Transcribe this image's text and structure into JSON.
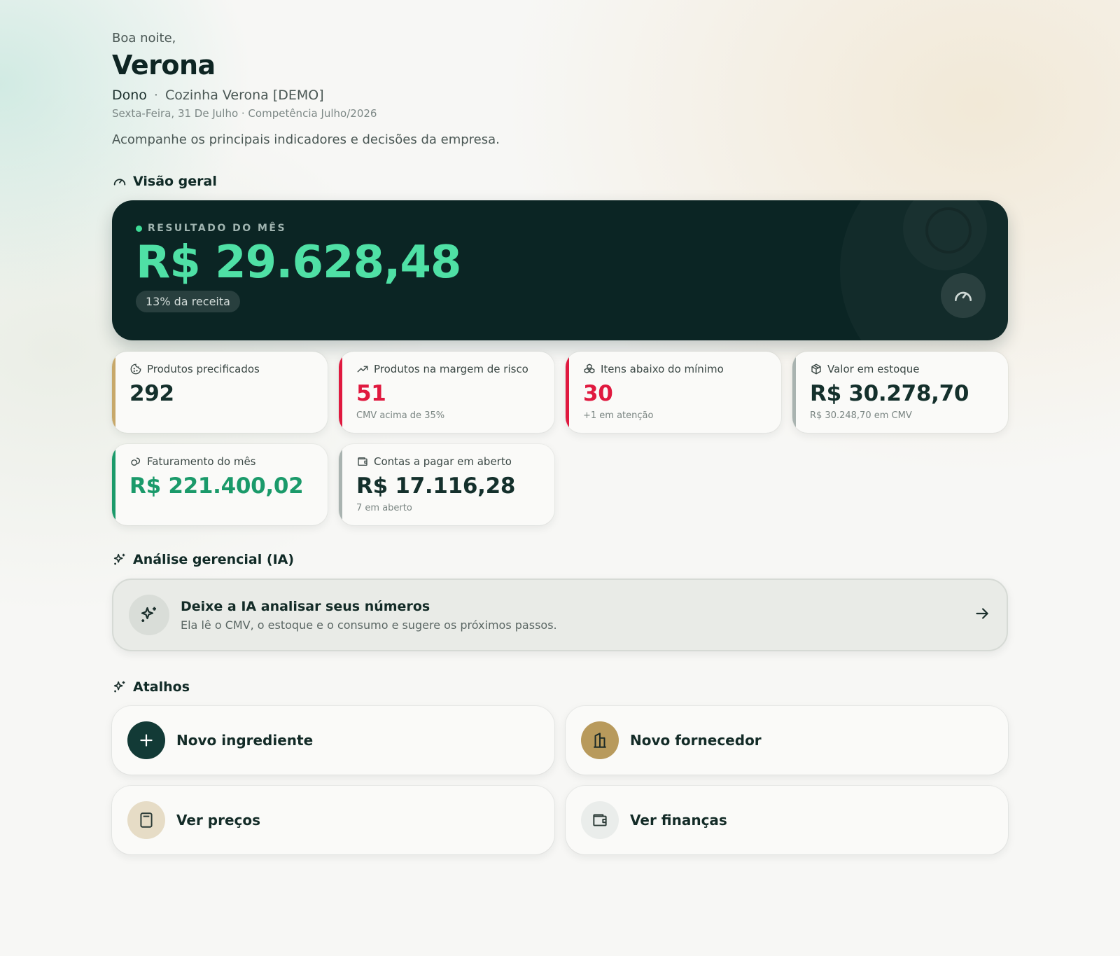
{
  "header": {
    "greeting": "Boa noite,",
    "name": "Verona",
    "role": "Dono",
    "separator": "·",
    "company": "Cozinha Verona [DEMO]",
    "date": "Sexta-Feira, 31 De Julho · Competência Julho/2026",
    "intro": "Acompanhe os principais indicadores e decisões da empresa."
  },
  "overview": {
    "title": "Visão geral",
    "icon": "gauge-icon",
    "hero": {
      "label": "RESULTADO DO MÊS",
      "value": "R$ 29.628,48",
      "pill": "13% da receita",
      "value_color": "#4fe0a5",
      "background": "#0b2524"
    },
    "kpis": [
      {
        "label": "Produtos precificados",
        "icon": "cookie-icon",
        "value": "292",
        "sub": "",
        "accent": "#c7a86a",
        "tone": "default"
      },
      {
        "label": "Produtos na margem de risco",
        "icon": "trending-up-icon",
        "value": "51",
        "sub": "CMV acima de 35%",
        "accent": "#e0193f",
        "tone": "red"
      },
      {
        "label": "Itens abaixo do mínimo",
        "icon": "boxes-icon",
        "value": "30",
        "sub": "+1 em atenção",
        "accent": "#e0193f",
        "tone": "red"
      },
      {
        "label": "Valor em estoque",
        "icon": "package-icon",
        "value": "R$ 30.278,70",
        "sub": "R$ 30.248,70 em CMV",
        "accent": "#a9b3b0",
        "tone": "default"
      },
      {
        "label": "Faturamento do mês",
        "icon": "coins-icon",
        "value": "R$ 221.400,02",
        "sub": "",
        "accent": "#1a9a6a",
        "tone": "green"
      },
      {
        "label": "Contas a pagar em aberto",
        "icon": "wallet-icon",
        "value": "R$ 17.116,28",
        "sub": "7 em aberto",
        "accent": "#a9b3b0",
        "tone": "default"
      }
    ]
  },
  "ia": {
    "title": "Análise gerencial (IA)",
    "icon": "sparkles-icon",
    "card_title": "Deixe a IA analisar seus números",
    "card_sub": "Ela lê o CMV, o estoque e o consumo e sugere os próximos passos."
  },
  "shortcuts": {
    "title": "Atalhos",
    "icon": "sparkles-icon",
    "items": [
      {
        "label": "Novo ingrediente",
        "icon": "plus-icon",
        "bg": "#123a36",
        "fg": "#ffffff"
      },
      {
        "label": "Novo fornecedor",
        "icon": "building-icon",
        "bg": "#b89a5c",
        "fg": "#1b2a27"
      },
      {
        "label": "Ver preços",
        "icon": "calculator-icon",
        "bg": "#e6dcc6",
        "fg": "#2a3a36"
      },
      {
        "label": "Ver finanças",
        "icon": "wallet-icon",
        "bg": "#eaedeb",
        "fg": "#2a3a36"
      }
    ]
  }
}
